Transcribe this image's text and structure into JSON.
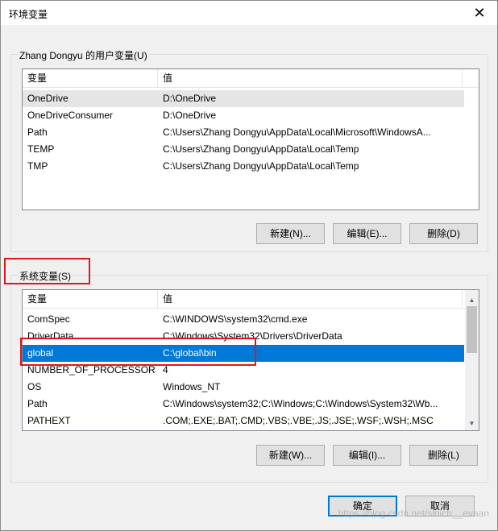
{
  "window": {
    "title": "环境变量",
    "close_glyph": "✕"
  },
  "user_vars": {
    "legend": "Zhang Dongyu 的用户变量(U)",
    "header": {
      "name": "变量",
      "value": "值"
    },
    "rows": [
      {
        "name": "OneDrive",
        "value": "D:\\OneDrive"
      },
      {
        "name": "OneDriveConsumer",
        "value": "D:\\OneDrive"
      },
      {
        "name": "Path",
        "value": "C:\\Users\\Zhang Dongyu\\AppData\\Local\\Microsoft\\WindowsA..."
      },
      {
        "name": "TEMP",
        "value": "C:\\Users\\Zhang Dongyu\\AppData\\Local\\Temp"
      },
      {
        "name": "TMP",
        "value": "C:\\Users\\Zhang Dongyu\\AppData\\Local\\Temp"
      }
    ],
    "buttons": {
      "new": "新建(N)...",
      "edit": "编辑(E)...",
      "delete": "删除(D)"
    }
  },
  "system_vars": {
    "legend": "系统变量(S)",
    "header": {
      "name": "变量",
      "value": "值"
    },
    "rows": [
      {
        "name": "ComSpec",
        "value": "C:\\WINDOWS\\system32\\cmd.exe"
      },
      {
        "name": "DriverData",
        "value": "C:\\Windows\\System32\\Drivers\\DriverData"
      },
      {
        "name": "global",
        "value": "C:\\global\\bin"
      },
      {
        "name": "NUMBER_OF_PROCESSORS",
        "value": "4"
      },
      {
        "name": "OS",
        "value": "Windows_NT"
      },
      {
        "name": "Path",
        "value": "C:\\Windows\\system32;C:\\Windows;C:\\Windows\\System32\\Wb..."
      },
      {
        "name": "PATHEXT",
        "value": ".COM;.EXE;.BAT;.CMD;.VBS;.VBE;.JS;.JSE;.WSF;.WSH;.MSC"
      }
    ],
    "buttons": {
      "new": "新建(W)...",
      "edit": "编辑(I)...",
      "delete": "删除(L)"
    }
  },
  "footer": {
    "ok": "确定",
    "cancel": "取消"
  },
  "watermark": "https://blog.csdn.net/sinich__evaan",
  "colors": {
    "selection_blue": "#0078d7",
    "annotation_red": "#e0161c"
  }
}
